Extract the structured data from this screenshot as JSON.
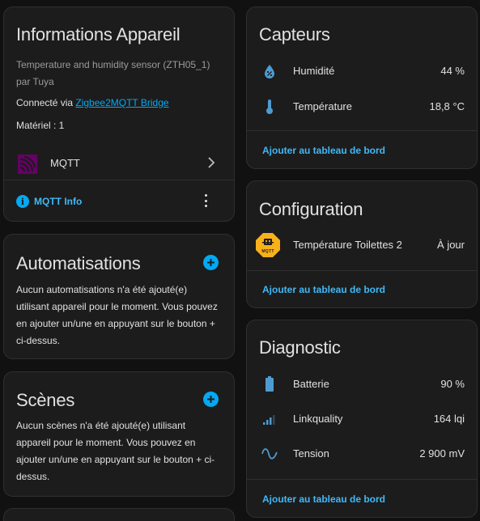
{
  "device_info": {
    "title": "Informations Appareil",
    "model": "Temperature and humidity sensor (ZTH05_1)",
    "manufacturer": "par Tuya",
    "connected_prefix": "Connecté via",
    "connected_link": "Zigbee2MQTT Bridge",
    "hardware": "Matériel : 1",
    "mqtt_label": "MQTT",
    "mqtt_info_label": "MQTT Info"
  },
  "automations": {
    "title": "Automatisations",
    "description": "Aucun automatisations n'a été ajouté(e) utilisant appareil pour le moment. Vous pouvez en ajouter un/une en appuyant sur le bouton + ci-dessus."
  },
  "scenes": {
    "title": "Scènes",
    "description": "Aucun scènes n'a été ajouté(e) utilisant appareil pour le moment. Vous pouvez en ajouter un/une en appuyant sur le bouton + ci-dessus."
  },
  "sensors": {
    "title": "Capteurs",
    "items": [
      {
        "label": "Humidité",
        "value": "44 %",
        "icon": "water-percent-icon"
      },
      {
        "label": "Température",
        "value": "18,8 °C",
        "icon": "thermometer-icon"
      }
    ],
    "add_label": "Ajouter au tableau de bord"
  },
  "configuration": {
    "title": "Configuration",
    "items": [
      {
        "label": "Température Toilettes 2",
        "value": "À jour",
        "icon": "mqtt-update-icon",
        "icon_text": "MQTT"
      }
    ],
    "add_label": "Ajouter au tableau de bord"
  },
  "diagnostic": {
    "title": "Diagnostic",
    "items": [
      {
        "label": "Batterie",
        "value": "90 %",
        "icon": "battery-icon"
      },
      {
        "label": "Linkquality",
        "value": "164 lqi",
        "icon": "signal-icon"
      },
      {
        "label": "Tension",
        "value": "2 900 mV",
        "icon": "sine-wave-icon"
      }
    ],
    "add_label": "Ajouter au tableau de bord"
  },
  "colors": {
    "background": "#111111",
    "card": "#1c1c1c",
    "accent": "#03a9f4",
    "icon": "#4f9bd1",
    "mqtt_purple": "#660066",
    "update_badge": "#f8b11b"
  }
}
